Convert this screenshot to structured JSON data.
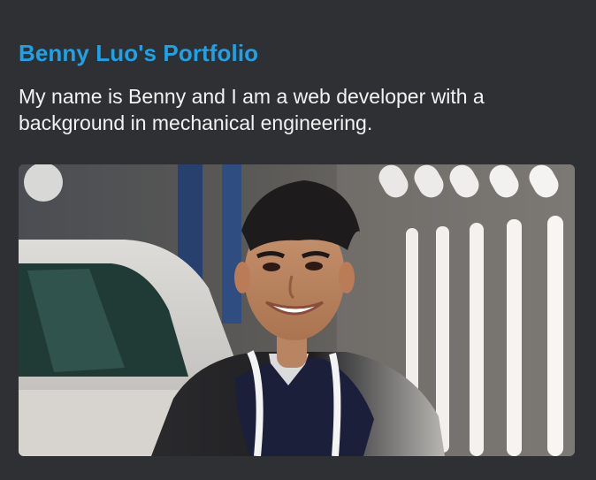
{
  "portfolio": {
    "title": "Benny Luo's Portfolio",
    "intro": "My name is Benny and I am a web developer with a background in mechanical engineering."
  },
  "theme": {
    "background": "#2f3033",
    "title_color": "#1ea2e6",
    "text_color": "#f2f2f2"
  },
  "photo": {
    "icon": "portrait-photo"
  }
}
